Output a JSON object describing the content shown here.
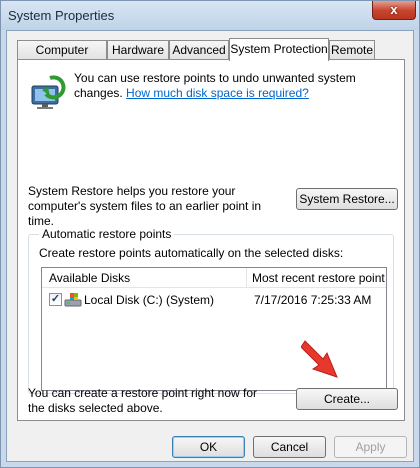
{
  "window": {
    "title": "System Properties",
    "close_glyph": "x"
  },
  "tabs": [
    {
      "label": "Computer Name",
      "active": false
    },
    {
      "label": "Hardware",
      "active": false
    },
    {
      "label": "Advanced",
      "active": false
    },
    {
      "label": "System Protection",
      "active": true
    },
    {
      "label": "Remote",
      "active": false
    }
  ],
  "protection": {
    "intro_text": "You can use restore points to undo unwanted system changes.",
    "link_text": "How much disk space is required?",
    "restore_text": "System Restore helps you restore your computer's system files to an earlier point in time.",
    "restore_button": "System Restore..."
  },
  "auto_restore": {
    "group_title": "Automatic restore points",
    "description": "Create restore points automatically on the selected disks:",
    "columns": [
      "Available Disks",
      "Most recent restore point"
    ],
    "rows": [
      {
        "checked": true,
        "disk": "Local Disk (C:) (System)",
        "date": "7/17/2016 7:25:33 AM"
      }
    ]
  },
  "create": {
    "text": "You can create a restore point right now for the disks selected above.",
    "button": "Create..."
  },
  "footer": {
    "ok": "OK",
    "cancel": "Cancel",
    "apply": "Apply"
  },
  "icons": {
    "shield": "system-restore-icon",
    "disk": "drive-icon",
    "annotation": "red-arrow-icon"
  },
  "colors": {
    "accent": "#0066cc",
    "arrow": "#e8382d"
  }
}
